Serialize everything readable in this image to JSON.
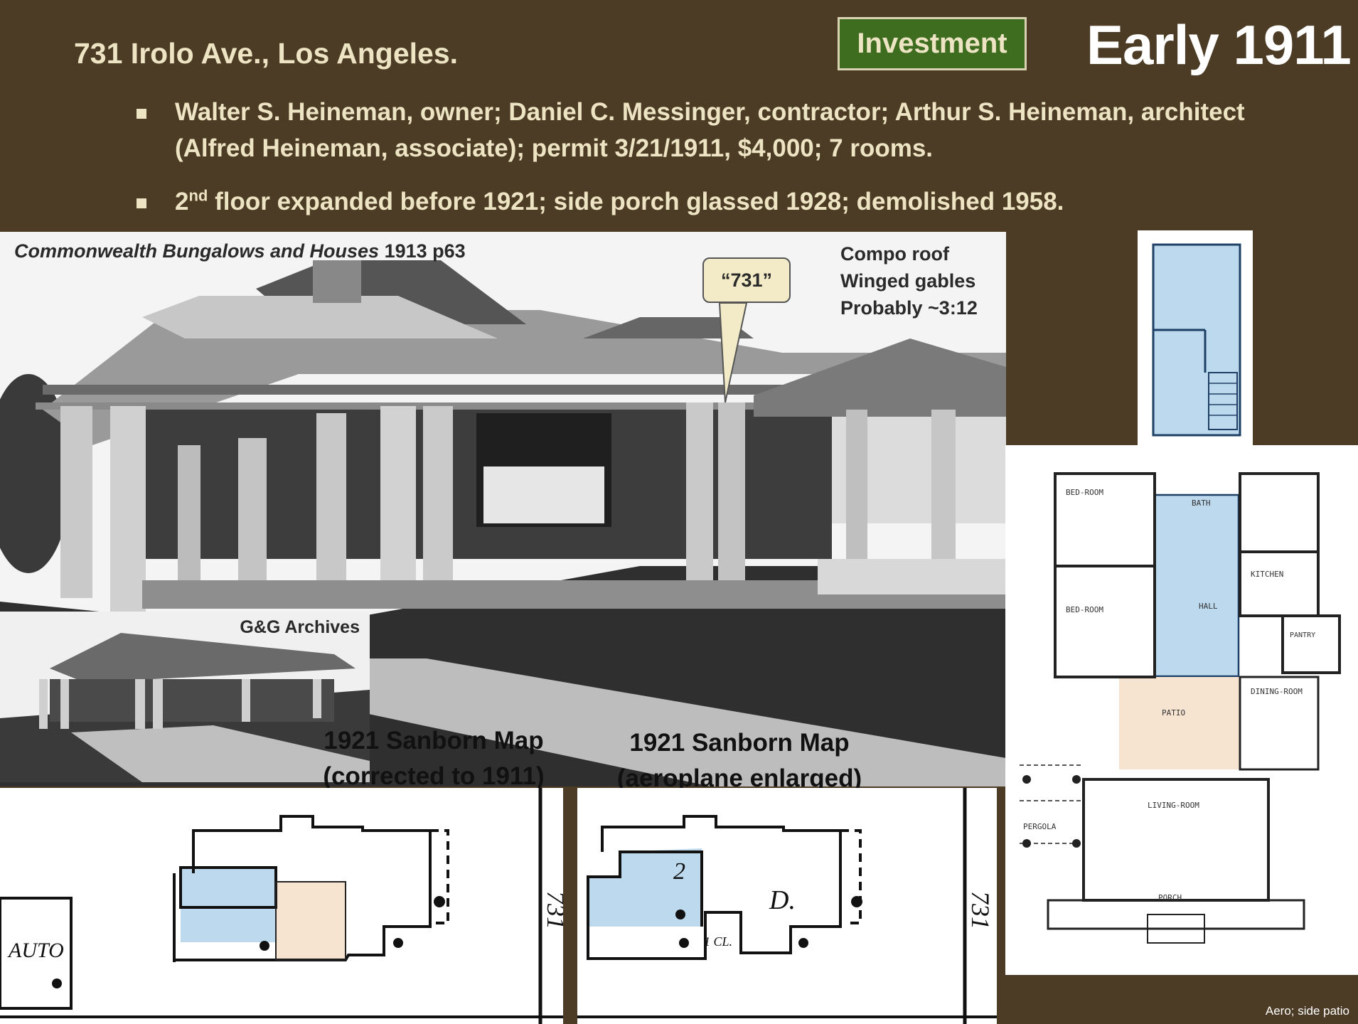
{
  "header": {
    "address": "731 Irolo Ave., Los Angeles.",
    "badge": "Investment",
    "title": "Early 1911"
  },
  "bullets": [
    "Walter S. Heineman, owner; Daniel C. Messinger, contractor; Arthur S. Heineman, architect (Alfred Heineman, associate); permit 3/21/1911, $4,000; 7 rooms.",
    {
      "pre": "2",
      "sup": "nd",
      "post": " floor expanded before 1921; side porch glassed 1928; demolished 1958."
    }
  ],
  "photo": {
    "source_italic": "Commonwealth Bungalows and Houses",
    "source_tail": "1913 p63",
    "callout": "“731”",
    "notes": [
      "Compo roof",
      "Winged gables",
      "Probably ~3:12"
    ]
  },
  "inset": {
    "label": "G&G Archives"
  },
  "maps": [
    {
      "title_line1": "1921 Sanborn Map",
      "title_line2": "(corrected to 1911)",
      "labels": [
        "AUTO",
        "731"
      ]
    },
    {
      "title_line1": "1921 Sanborn Map",
      "title_line2": "(aeroplane enlarged)",
      "labels": [
        "731",
        "2",
        "D.",
        "1 CL."
      ]
    }
  ],
  "plan": {
    "rooms": [
      "BED-ROOM",
      "BATH",
      "BED-ROOM",
      "HALL",
      "KITCHEN",
      "PATIO",
      "DINING-ROOM",
      "LIVING-ROOM",
      "PERGOLA",
      "PORCH",
      "PANTRY"
    ]
  },
  "footer": {
    "note": "Aero; side patio"
  },
  "colors": {
    "background": "#4d3c25",
    "text": "#ede4c4",
    "badge": "#3f6d20",
    "blue_highlight": "#bcd9ee",
    "tan_highlight": "#f6e3d0"
  }
}
